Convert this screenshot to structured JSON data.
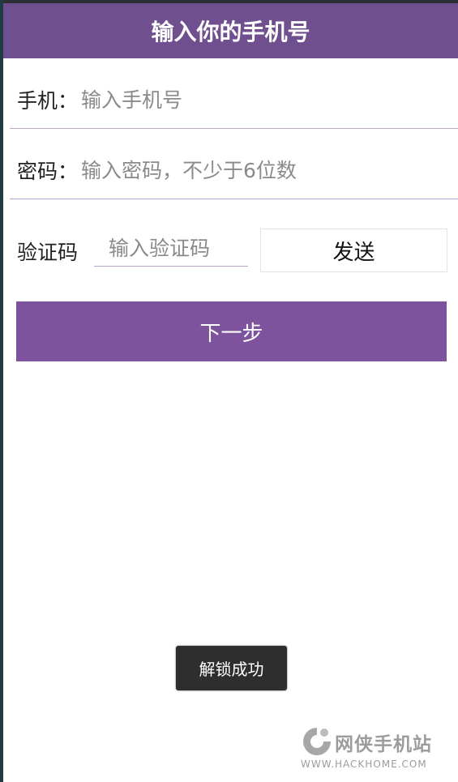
{
  "header": {
    "title": "输入你的手机号"
  },
  "form": {
    "phone_label": "手机：",
    "phone_placeholder": "输入手机号",
    "password_label": "密码：",
    "password_placeholder": "输入密码，不少于6位数",
    "code_label": "验证码",
    "code_placeholder": "输入验证码",
    "send_label": "发送",
    "next_label": "下一步"
  },
  "toast": {
    "message": "解锁成功"
  },
  "watermark": {
    "name": "网侠手机站",
    "url": "WWW.HACKHOME.COM"
  },
  "colors": {
    "primary": "#6f4f8e",
    "button": "#7d539d",
    "toast": "#2e2e2e"
  }
}
